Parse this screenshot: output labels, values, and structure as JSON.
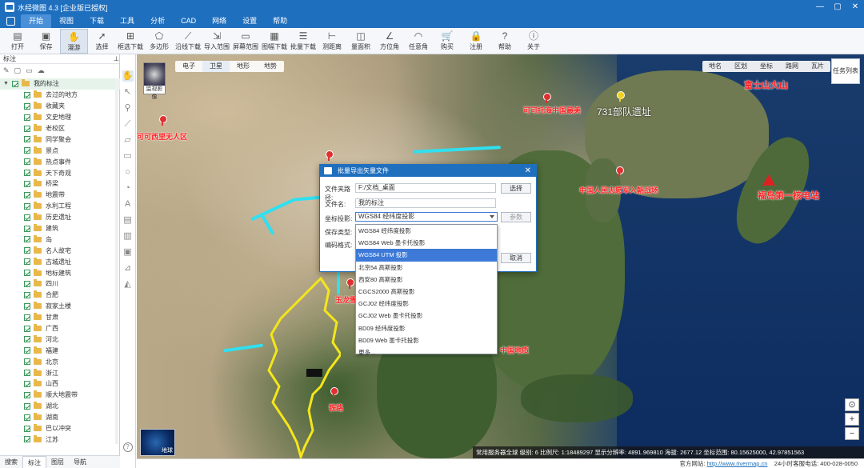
{
  "window": {
    "title": "水经微图 4.3 [企业版已授权]",
    "controls": [
      "—",
      "▢",
      "✕"
    ]
  },
  "menu": [
    "开始",
    "视图",
    "下载",
    "工具",
    "分析",
    "CAD",
    "网络",
    "设置",
    "帮助"
  ],
  "toolbar": [
    {
      "label": "打开",
      "icon": "folder-open-icon"
    },
    {
      "label": "保存",
      "icon": "save-icon"
    },
    {
      "label": "漫游",
      "icon": "hand-icon"
    },
    {
      "label": "选择",
      "icon": "cursor-icon"
    },
    {
      "label": "框选下载",
      "icon": "box-select-icon"
    },
    {
      "label": "多边形",
      "icon": "polygon-icon"
    },
    {
      "label": "沿线下载",
      "icon": "polyline-icon"
    },
    {
      "label": "导入范围",
      "icon": "import-icon"
    },
    {
      "label": "屏幕范围",
      "icon": "screen-icon"
    },
    {
      "label": "图幅下载",
      "icon": "grid-icon"
    },
    {
      "label": "批量下载",
      "icon": "batch-icon"
    },
    {
      "label": "测距离",
      "icon": "ruler-icon"
    },
    {
      "label": "量面积",
      "icon": "area-icon"
    },
    {
      "label": "方位角",
      "icon": "angle-icon"
    },
    {
      "label": "任意角",
      "icon": "protractor-icon"
    },
    {
      "label": "购买",
      "icon": "cart-icon"
    },
    {
      "label": "注册",
      "icon": "lock-icon"
    },
    {
      "label": "帮助",
      "icon": "help-icon"
    },
    {
      "label": "关于",
      "icon": "info-icon"
    }
  ],
  "panel": {
    "title": "标注",
    "root": "我的标注",
    "items": [
      "去过的地方",
      "收藏夹",
      "文史地理",
      "老校区",
      "同学聚会",
      "景点",
      "热点事件",
      "天下奇观",
      "桥梁",
      "地震带",
      "水利工程",
      "历史遗址",
      "建筑",
      "岛",
      "名人故宅",
      "古城遗址",
      "地标建筑",
      "四川",
      "合肥",
      "寂家土楼",
      "甘肃",
      "广西",
      "河北",
      "福建",
      "北京",
      "浙江",
      "山西",
      "顺大地震带",
      "湖北",
      "湖南",
      "巴以冲突",
      "江苏"
    ],
    "tabs": [
      "搜索",
      "标注",
      "图层",
      "导航"
    ]
  },
  "map": {
    "tabs": [
      "电子",
      "卫星",
      "地形",
      "地势"
    ],
    "active_tab": "卫星",
    "right_tabs": [
      "地名",
      "区划",
      "坐标",
      "路网",
      "瓦片"
    ],
    "task_list": "任务列表",
    "thumb_label": "监视影像",
    "globe_label": "地球",
    "labels": [
      {
        "text": "可可西里无人区",
        "cls": "sm"
      },
      {
        "text": "可可托海中国最美",
        "cls": "sm"
      },
      {
        "text": "731部队遗址",
        "cls": "w"
      },
      {
        "text": "富士山火山",
        "cls": ""
      },
      {
        "text": "中国人民志愿军入朝战场",
        "cls": "sm"
      },
      {
        "text": "福岛第一核电站",
        "cls": ""
      },
      {
        "text": "中国地质",
        "cls": "sm"
      },
      {
        "text": "玉龙雪",
        "cls": "sm"
      },
      {
        "text": "铁路",
        "cls": "sm"
      }
    ],
    "status": "常用服务器全球  级别:  6  比例尺:  1:18489297   显示分辨率:  4891.969810   海拔:  2677.12  坐标范围:  80.15625000, 42.97851563"
  },
  "footer": {
    "site_label": "官方网站:",
    "url": "http://www.rivermap.cn",
    "phone": "24小时客服电话: 400-028-0050"
  },
  "dialog": {
    "title": "批量导出矢量文件",
    "path_label": "文件夹路径:",
    "path_value": "F:/文档_桌面",
    "browse": "选择",
    "name_label": "文件名:",
    "name_value": "我的标注",
    "proj_label": "坐标投影:",
    "proj_value": "WGS84 经纬度投影",
    "params": "参数",
    "save_type_label": "保存类型:",
    "encoding_label": "编码格式:",
    "cancel": "取消",
    "options": [
      "WGS84 经纬度投影",
      "WGS84 Web 墨卡托投影",
      "WGS84 UTM 投影",
      "北京54 高斯投影",
      "西安80 高斯投影",
      "CGCS2000 高斯投影",
      "GCJ02 经纬度投影",
      "GCJ02 Web 墨卡托投影",
      "BD09 经纬度投影",
      "BD09 Web 墨卡托投影",
      "更多..."
    ],
    "selected_option": "WGS84 UTM 投影"
  },
  "colors": {
    "titlebar": "#1f6fbf",
    "selected": "#3d7ad8",
    "route": "#2fe0f0",
    "border_yellow": "#f5e61a",
    "label_red": "#ff2020"
  }
}
